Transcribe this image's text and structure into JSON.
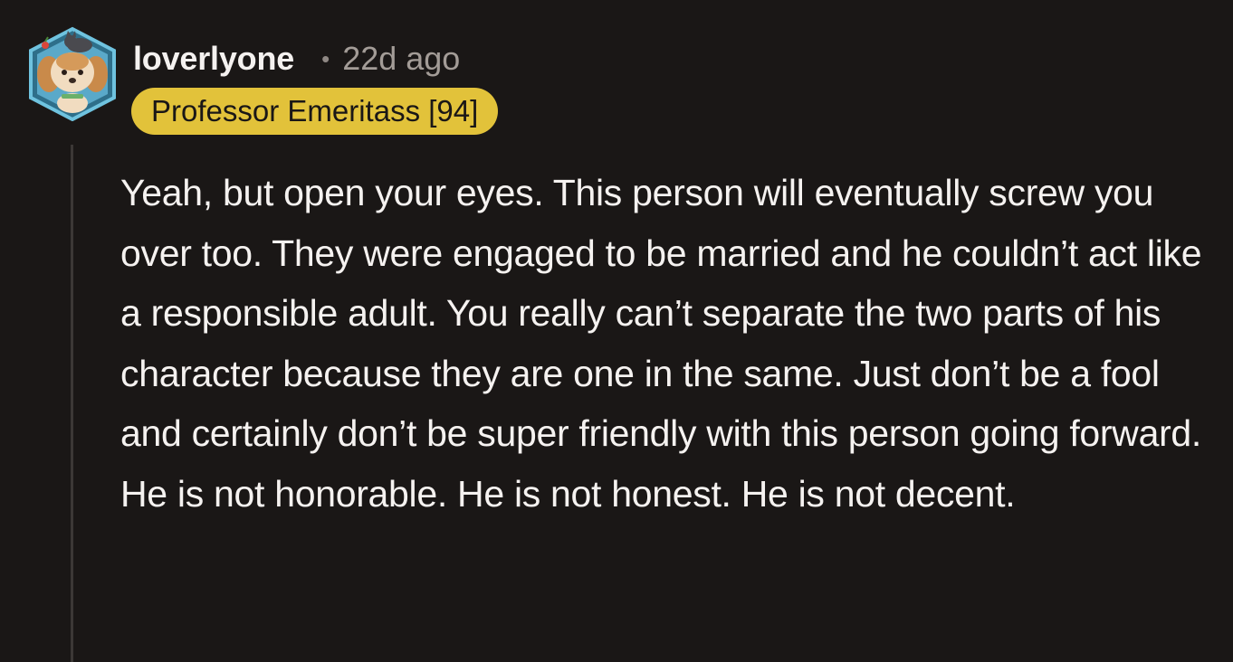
{
  "comment": {
    "username": "loverlyone",
    "separator": "•",
    "timestamp": "22d ago",
    "flair": "Professor Emeritass [94]",
    "body": "Yeah, but open your eyes. This person will eventually screw you over too. They were engaged to be married and he couldn’t act like a responsible adult. You really can’t separate the two parts of his character because they are one in the same. Just don’t be a fool and certainly don’t be super friendly with this person going forward. He is not honorable. He is not honest. He is not decent."
  },
  "colors": {
    "background": "#1a1716",
    "flair_background": "#e2c23a",
    "text": "#f5f2f0",
    "muted": "#a39c97",
    "avatar_frame": "#5fb7d6"
  },
  "icons": {
    "avatar": "dog-avatar-icon"
  }
}
